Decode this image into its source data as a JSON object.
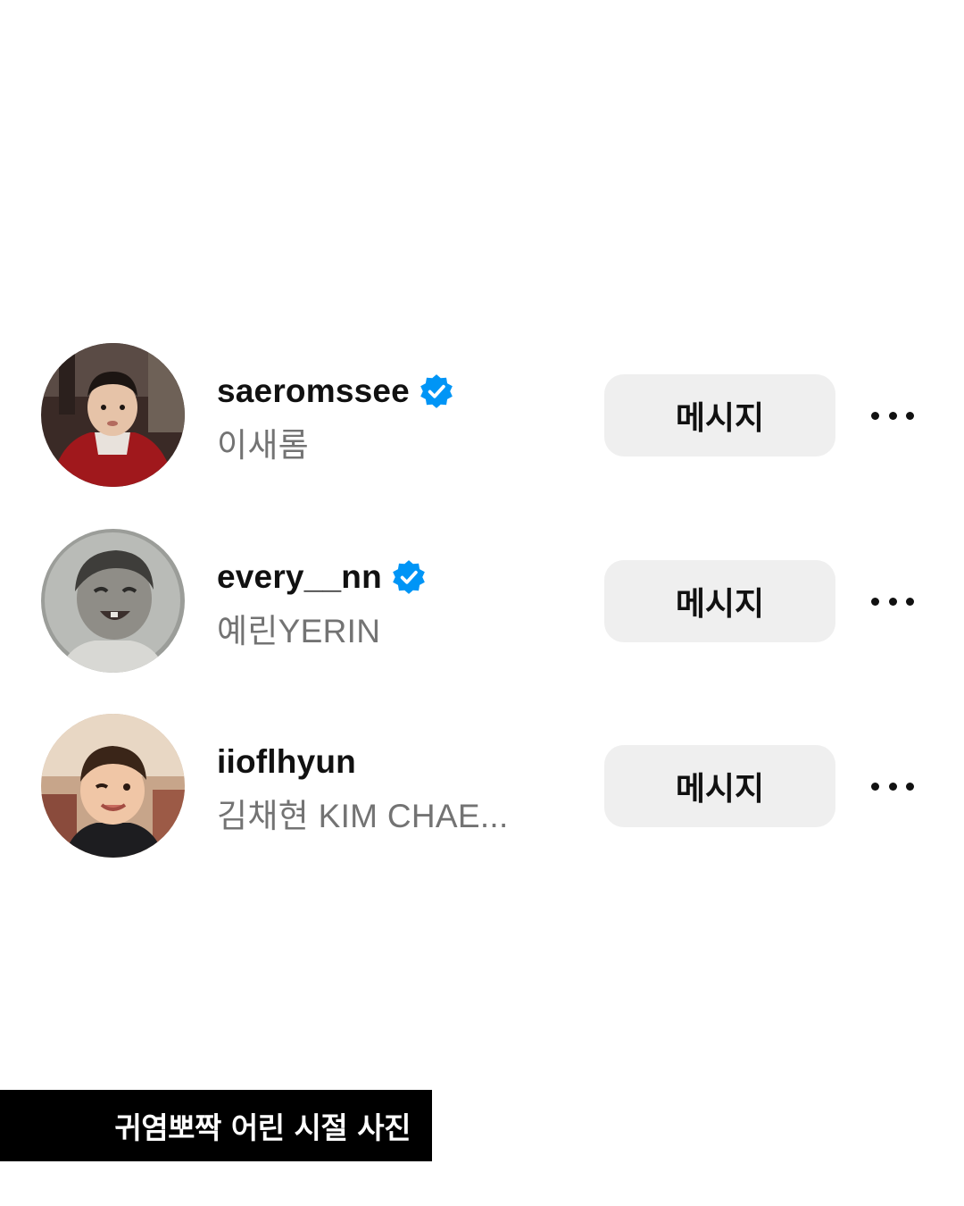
{
  "accounts": [
    {
      "username": "saeromssee",
      "full_name": "이새롬",
      "verified": true,
      "avatar": "childhood-photo-red-jacket",
      "message_label": "메시지",
      "more_icon": "more-horizontal-icon"
    },
    {
      "username": "every__nn",
      "full_name": "예린YERIN",
      "verified": true,
      "avatar": "childhood-photo-laughing-bw",
      "message_label": "메시지",
      "more_icon": "more-horizontal-icon"
    },
    {
      "username": "iioflhyun",
      "full_name": "김채현 KIM CHAE...",
      "verified": false,
      "avatar": "childhood-photo-winking",
      "message_label": "메시지",
      "more_icon": "more-horizontal-icon"
    }
  ],
  "caption": "귀염뽀짝 어린 시절 사진",
  "colors": {
    "verified_badge": "#0095f6",
    "button_background": "#efefef",
    "secondary_text": "#737373",
    "caption_background": "#000000"
  }
}
